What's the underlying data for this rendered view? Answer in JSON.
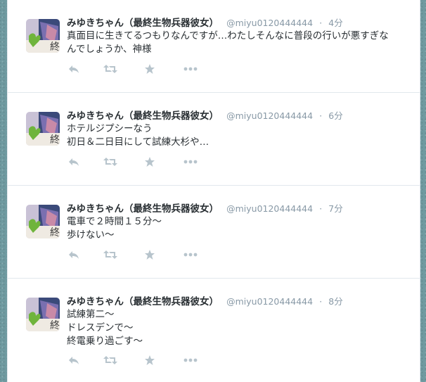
{
  "tweets": [
    {
      "name": "みゆきちゃん（最終生物兵器彼女）",
      "handle": "@miyu0120444444",
      "time": "4分",
      "text": "真面目に生きてるつもりなんですが…わたしそんなに普段の行いが悪すぎな\nんでしょうか、神様"
    },
    {
      "name": "みゆきちゃん（最終生物兵器彼女）",
      "handle": "@miyu0120444444",
      "time": "6分",
      "text": "ホテルジプシーなう\n初日＆二日目にして試練大杉や…"
    },
    {
      "name": "みゆきちゃん（最終生物兵器彼女）",
      "handle": "@miyu0120444444",
      "time": "7分",
      "text": "電車で２時間１５分〜\n歩けない〜"
    },
    {
      "name": "みゆきちゃん（最終生物兵器彼女）",
      "handle": "@miyu0120444444",
      "time": "8分",
      "text": "試練第二〜\nドレスデンで〜\n終電乗り過ごす〜"
    }
  ],
  "separator": "·",
  "icons": {
    "reply": "reply-icon",
    "retweet": "retweet-icon",
    "favorite": "star-icon",
    "more": "more-icon"
  },
  "colors": {
    "background": "#6f9aa0",
    "text": "#292f33",
    "meta": "#8899a6",
    "action": "#b7c4cc"
  }
}
